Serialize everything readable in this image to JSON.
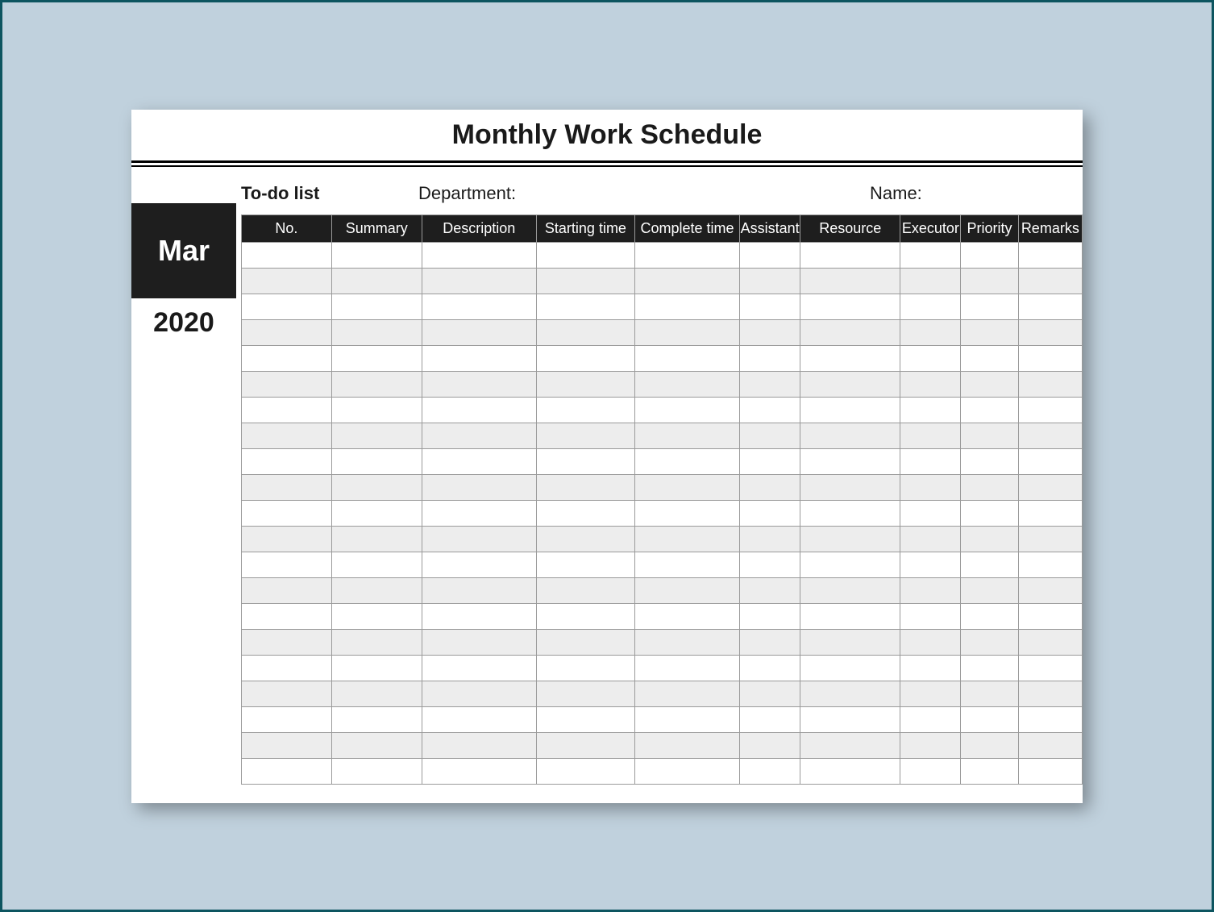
{
  "title": "Monthly Work Schedule",
  "sidebar": {
    "month": "Mar",
    "year": "2020"
  },
  "info": {
    "todo_label": "To-do list",
    "department_label": "Department:",
    "name_label": "Name:"
  },
  "table": {
    "columns": [
      "No.",
      "Summary",
      "Description",
      "Starting time",
      "Complete time",
      "Assistant",
      "Resource",
      "Executor",
      "Priority",
      "Remarks"
    ],
    "row_count": 21
  }
}
